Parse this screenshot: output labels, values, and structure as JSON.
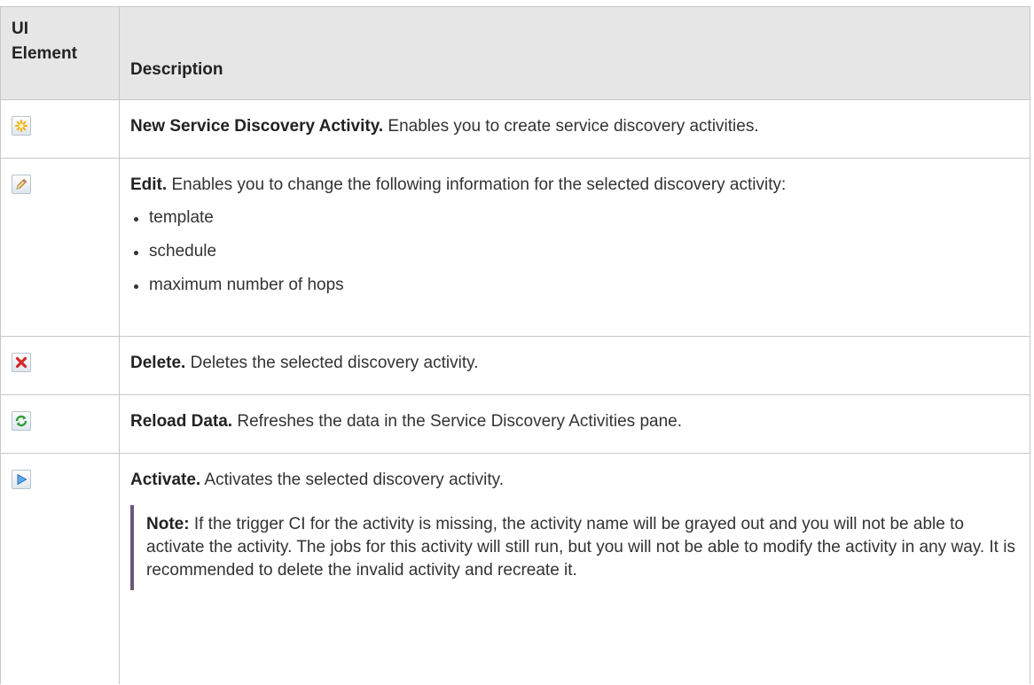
{
  "header": {
    "col1_line1": "UI",
    "col1_line2": "Element",
    "col2": "Description"
  },
  "rows": [
    {
      "icon": "new-star-icon",
      "title": "New Service Discovery Activity.",
      "text": " Enables you to create service discovery activities."
    },
    {
      "icon": "pencil-edit-icon",
      "title": "Edit.",
      "text": " Enables you to change the following information for the selected discovery activity:",
      "bullets": [
        "template",
        "schedule",
        "maximum number of hops"
      ]
    },
    {
      "icon": "red-x-delete-icon",
      "title": "Delete.",
      "text": " Deletes the selected discovery activity."
    },
    {
      "icon": "green-refresh-icon",
      "title": "Reload Data.",
      "text": " Refreshes the data in the Service Discovery Activities pane."
    },
    {
      "icon": "blue-play-icon",
      "title": "Activate.",
      "text": " Activates the selected discovery activity.",
      "note": {
        "label": "Note:",
        "text": "  If the trigger CI for the activity is missing, the activity name will be grayed out and you will not be able to activate the activity. The jobs for this activity will still run, but you will not be able to modify the activity in any way. It is recommended to delete the invalid activity and recreate it."
      }
    }
  ]
}
